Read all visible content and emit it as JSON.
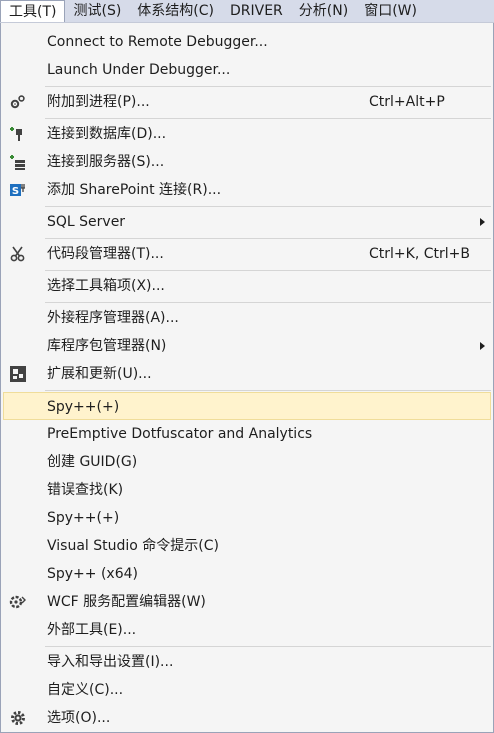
{
  "menubar": {
    "items": [
      "工具(T)",
      "测试(S)",
      "体系结构(C)",
      "DRIVER",
      "分析(N)",
      "窗口(W)"
    ]
  },
  "menu": {
    "items": [
      {
        "label": "Connect to Remote Debugger..."
      },
      {
        "label": "Launch Under Debugger..."
      },
      {
        "label": "附加到进程(P)...",
        "shortcut": "Ctrl+Alt+P",
        "icon": "attach-process-icon"
      },
      {
        "label": "连接到数据库(D)...",
        "icon": "connect-database-icon"
      },
      {
        "label": "连接到服务器(S)...",
        "icon": "connect-server-icon"
      },
      {
        "label": "添加 SharePoint 连接(R)...",
        "icon": "sharepoint-icon"
      },
      {
        "label": "SQL Server",
        "submenu": true
      },
      {
        "label": "代码段管理器(T)...",
        "shortcut": "Ctrl+K, Ctrl+B",
        "icon": "snippet-icon"
      },
      {
        "label": "选择工具箱项(X)..."
      },
      {
        "label": "外接程序管理器(A)..."
      },
      {
        "label": "库程序包管理器(N)",
        "submenu": true
      },
      {
        "label": "扩展和更新(U)...",
        "icon": "extensions-icon"
      },
      {
        "label": "Spy++(+)",
        "highlighted": true
      },
      {
        "label": "PreEmptive Dotfuscator and Analytics"
      },
      {
        "label": "创建 GUID(G)"
      },
      {
        "label": "错误查找(K)"
      },
      {
        "label": "Spy++(+)"
      },
      {
        "label": "Visual Studio 命令提示(C)"
      },
      {
        "label": "Spy++ (x64)"
      },
      {
        "label": "WCF 服务配置编辑器(W)",
        "icon": "wcf-config-icon"
      },
      {
        "label": "外部工具(E)..."
      },
      {
        "label": "导入和导出设置(I)..."
      },
      {
        "label": "自定义(C)..."
      },
      {
        "label": "选项(O)...",
        "icon": "gear-icon"
      }
    ]
  },
  "colors": {
    "menubar_bg": "#d6dbe9",
    "menu_bg": "#f5f5f5",
    "highlight_bg": "#fff3cd",
    "icon_dark": "#424242",
    "icon_green": "#388a34",
    "icon_blue": "#1e6fbf"
  }
}
